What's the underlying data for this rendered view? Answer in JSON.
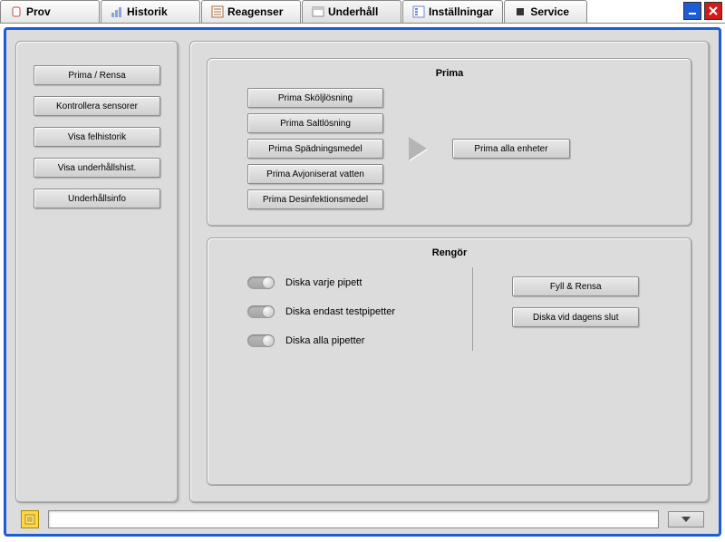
{
  "tabs": {
    "prov": "Prov",
    "historik": "Historik",
    "reagenser": "Reagenser",
    "underhall": "Underhåll",
    "installningar": "Inställningar",
    "service": "Service"
  },
  "sidebar": {
    "prima_rensa": "Prima / Rensa",
    "kontrollera": "Kontrollera sensorer",
    "felhistorik": "Visa felhistorik",
    "underhallshist": "Visa underhållshist.",
    "underhallsinfo": "Underhållsinfo"
  },
  "prima": {
    "title": "Prima",
    "skolj": "Prima Sköljlösning",
    "salt": "Prima Saltlösning",
    "spad": "Prima Spädningsmedel",
    "avjon": "Prima Avjoniserat vatten",
    "desinf": "Prima Desinfektionsmedel",
    "alla": "Prima alla enheter"
  },
  "rengor": {
    "title": "Rengör",
    "varje": "Diska varje pipett",
    "test": "Diska endast testpipetter",
    "alla": "Diska alla pipetter",
    "fyll": "Fyll & Rensa",
    "slut": "Diska vid dagens slut"
  },
  "status": {
    "value": ""
  }
}
